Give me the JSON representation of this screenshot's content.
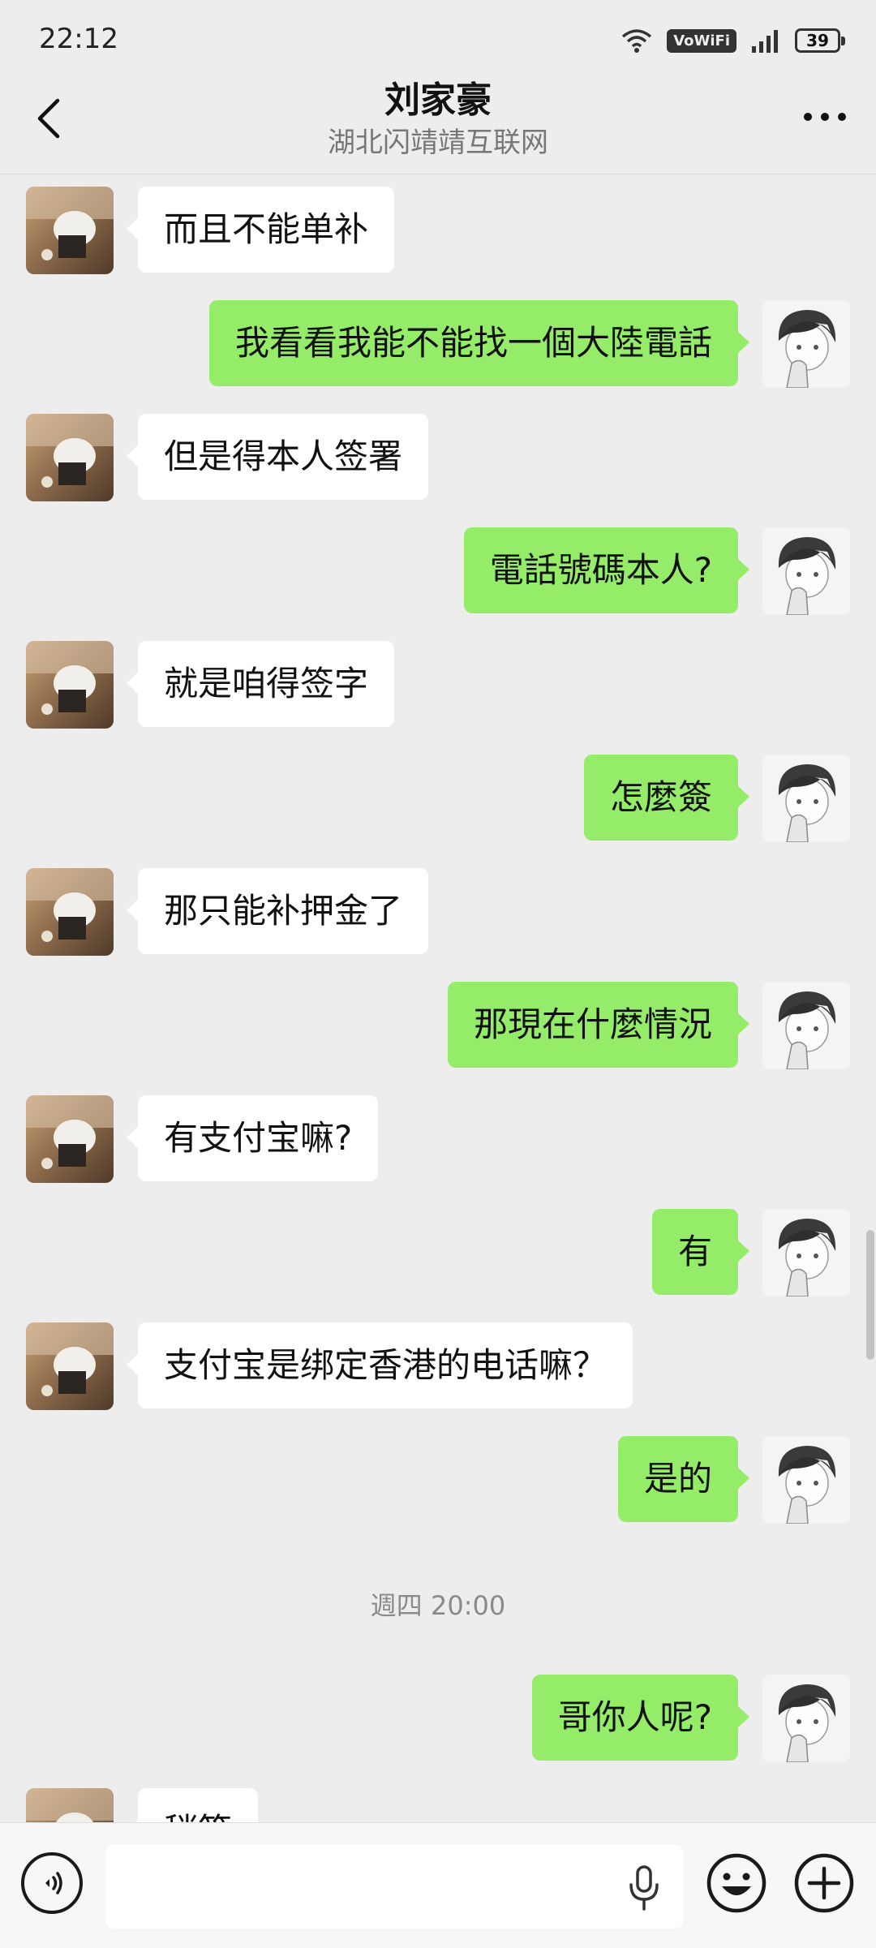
{
  "status_bar": {
    "time": "22:12",
    "vowifi": "VoWiFi",
    "battery": "39"
  },
  "header": {
    "title": "刘家豪",
    "subtitle": "湖北闪靖靖互联网"
  },
  "messages": [
    {
      "side": "left",
      "text": "而且不能单补"
    },
    {
      "side": "right",
      "text": "我看看我能不能找一個大陸電話"
    },
    {
      "side": "left",
      "text": "但是得本人签署"
    },
    {
      "side": "right",
      "text": "電話號碼本人?"
    },
    {
      "side": "left",
      "text": "就是咱得签字"
    },
    {
      "side": "right",
      "text": "怎麼簽"
    },
    {
      "side": "left",
      "text": "那只能补押金了"
    },
    {
      "side": "right",
      "text": "那現在什麼情況"
    },
    {
      "side": "left",
      "text": "有支付宝嘛?"
    },
    {
      "side": "right",
      "text": "有"
    },
    {
      "side": "left",
      "text": "支付宝是绑定香港的电话嘛？"
    },
    {
      "side": "right",
      "text": "是的"
    },
    {
      "side": "right",
      "text": "哥你人呢?"
    },
    {
      "side": "left",
      "text": "稍等"
    }
  ],
  "time_separator": "週四 20:00",
  "input": {
    "value": "",
    "placeholder": ""
  },
  "colors": {
    "background": "#ededed",
    "my_bubble": "#95ec69",
    "their_bubble": "#ffffff"
  },
  "icons": {
    "back": "back-arrow-icon",
    "more": "more-icon",
    "voice": "voice-icon",
    "mic": "microphone-icon",
    "emoji": "emoji-icon",
    "plus": "plus-icon"
  }
}
